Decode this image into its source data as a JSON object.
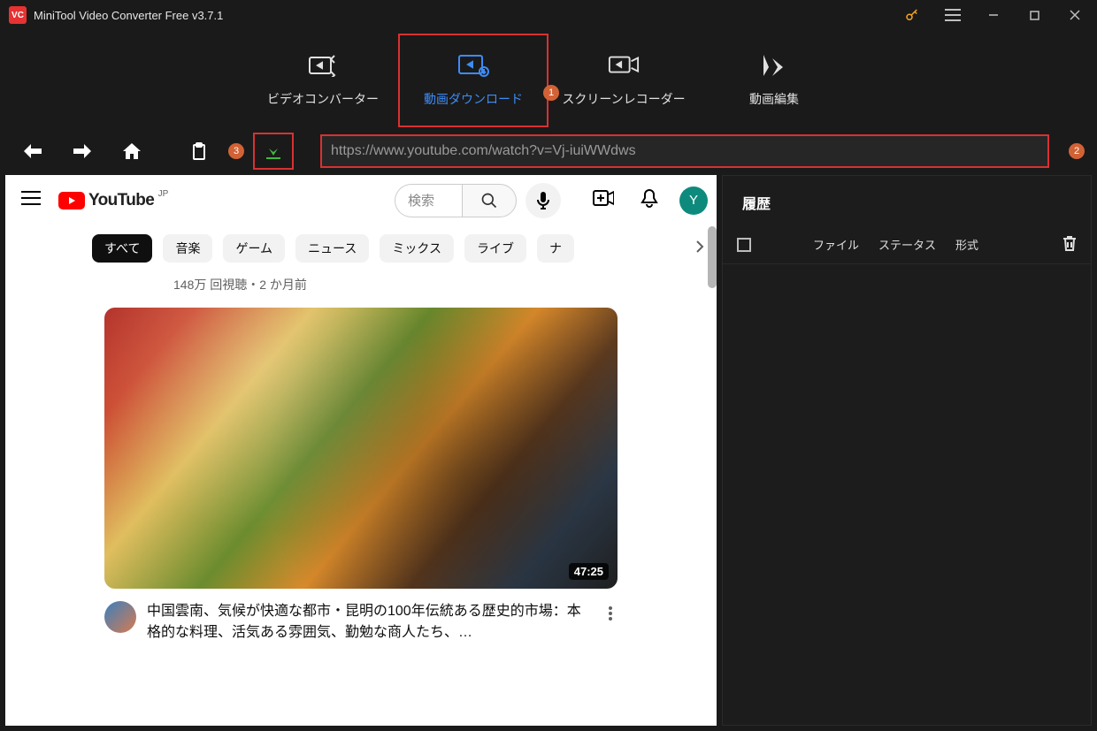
{
  "title": "MiniTool Video Converter Free v3.7.1",
  "nav": {
    "converter": "ビデオコンバーター",
    "download": "動画ダウンロード",
    "recorder": "スクリーンレコーダー",
    "editor": "動画編集",
    "badge1": "1"
  },
  "toolbar": {
    "badge3": "3",
    "url": "https://www.youtube.com/watch?v=Vj-iuiWWdws",
    "badge2": "2"
  },
  "youtube": {
    "brand": "YouTube",
    "region": "JP",
    "search_placeholder": "検索",
    "avatar_letter": "Y",
    "chips": [
      "すべて",
      "音楽",
      "ゲーム",
      "ニュース",
      "ミックス",
      "ライブ",
      "ナ"
    ],
    "meta": "148万 回視聴・2 か月前",
    "duration": "47:25",
    "video_title": "中国雲南、気候が快適な都市・昆明の100年伝統ある歴史的市場：本格的な料理、活気ある雰囲気、勤勉な商人たち、…"
  },
  "history": {
    "heading": "履歴",
    "cols": {
      "file": "ファイル",
      "status": "ステータス",
      "format": "形式"
    }
  }
}
